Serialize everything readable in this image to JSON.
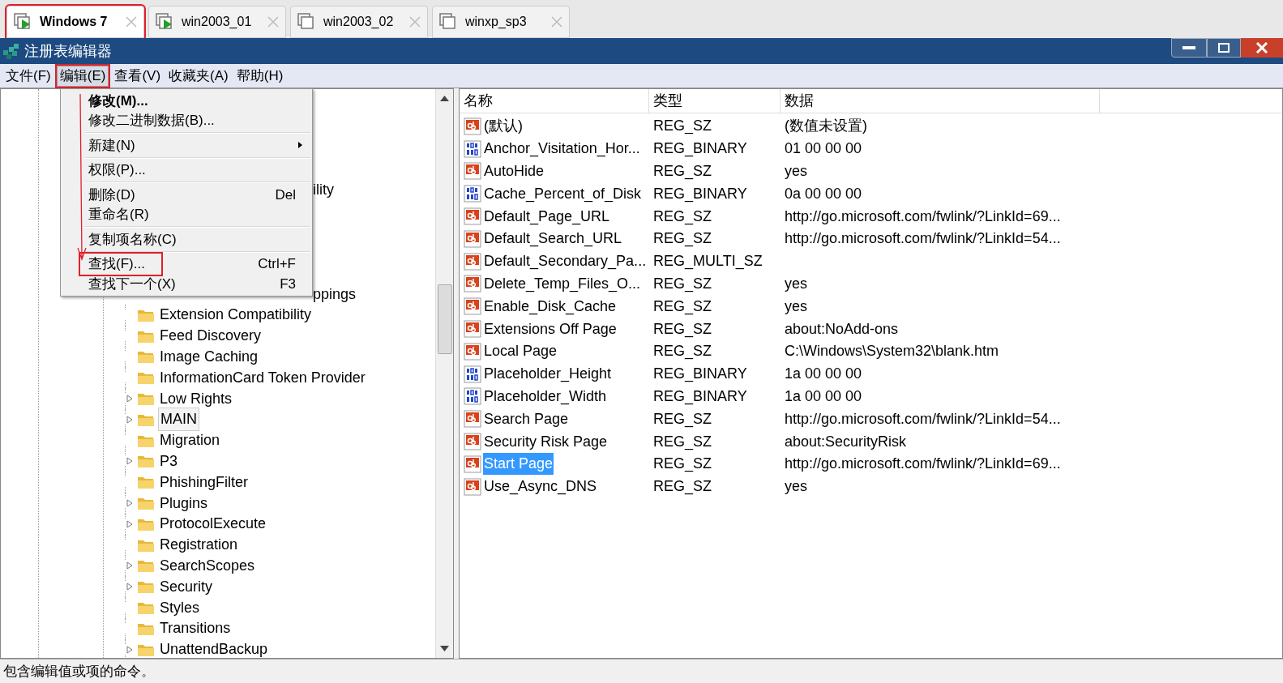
{
  "tabs": [
    {
      "label": "Windows 7",
      "selected": true,
      "running": true,
      "highlighted": true
    },
    {
      "label": "win2003_01",
      "selected": false,
      "running": true,
      "highlighted": false
    },
    {
      "label": "win2003_02",
      "selected": false,
      "running": false,
      "highlighted": false
    },
    {
      "label": "winxp_sp3",
      "selected": false,
      "running": false,
      "highlighted": false
    }
  ],
  "window": {
    "title": "注册表编辑器"
  },
  "menu_bar": [
    {
      "label": "文件(F)",
      "selected": false,
      "highlighted": false
    },
    {
      "label": "编辑(E)",
      "selected": true,
      "highlighted": true
    },
    {
      "label": "查看(V)",
      "selected": false,
      "highlighted": false
    },
    {
      "label": "收藏夹(A)",
      "selected": false,
      "highlighted": false
    },
    {
      "label": "帮助(H)",
      "selected": false,
      "highlighted": false
    }
  ],
  "edit_menu": [
    {
      "kind": "item",
      "label": "修改(M)...",
      "bold": true,
      "highlighted": false
    },
    {
      "kind": "item",
      "label": "修改二进制数据(B)...",
      "bold": false,
      "highlighted": false
    },
    {
      "kind": "separator"
    },
    {
      "kind": "submenu",
      "label": "新建(N)",
      "bold": false,
      "highlighted": false
    },
    {
      "kind": "separator"
    },
    {
      "kind": "item",
      "label": "权限(P)...",
      "bold": false,
      "highlighted": false
    },
    {
      "kind": "separator"
    },
    {
      "kind": "item",
      "label": "删除(D)",
      "shortcut": "Del",
      "bold": false,
      "highlighted": false
    },
    {
      "kind": "item",
      "label": "重命名(R)",
      "bold": false,
      "highlighted": false
    },
    {
      "kind": "separator"
    },
    {
      "kind": "item",
      "label": "复制项名称(C)",
      "bold": false,
      "highlighted": false
    },
    {
      "kind": "separator"
    },
    {
      "kind": "item",
      "label": "查找(F)...",
      "shortcut": "Ctrl+F",
      "bold": false,
      "highlighted": true
    },
    {
      "kind": "item",
      "label": "查找下一个(X)",
      "shortcut": "F3",
      "bold": false,
      "highlighted": false
    }
  ],
  "tree": [
    {
      "kind": "partial",
      "label": "ility"
    },
    {
      "kind": "partial",
      "label": "ppings"
    },
    {
      "kind": "key",
      "label": "Extension Compatibility",
      "expandable": false,
      "selected": false
    },
    {
      "kind": "key",
      "label": "Feed Discovery",
      "expandable": false,
      "selected": false
    },
    {
      "kind": "key",
      "label": "Image Caching",
      "expandable": false,
      "selected": false
    },
    {
      "kind": "key",
      "label": "InformationCard Token Provider",
      "expandable": false,
      "selected": false
    },
    {
      "kind": "key",
      "label": "Low Rights",
      "expandable": true,
      "selected": false
    },
    {
      "kind": "key",
      "label": "MAIN",
      "expandable": true,
      "selected": true
    },
    {
      "kind": "key",
      "label": "Migration",
      "expandable": false,
      "selected": false
    },
    {
      "kind": "key",
      "label": "P3",
      "expandable": true,
      "selected": false
    },
    {
      "kind": "key",
      "label": "PhishingFilter",
      "expandable": false,
      "selected": false
    },
    {
      "kind": "key",
      "label": "Plugins",
      "expandable": true,
      "selected": false
    },
    {
      "kind": "key",
      "label": "ProtocolExecute",
      "expandable": true,
      "selected": false
    },
    {
      "kind": "key",
      "label": "Registration",
      "expandable": false,
      "selected": false
    },
    {
      "kind": "key",
      "label": "SearchScopes",
      "expandable": true,
      "selected": false
    },
    {
      "kind": "key",
      "label": "Security",
      "expandable": true,
      "selected": false
    },
    {
      "kind": "key",
      "label": "Styles",
      "expandable": false,
      "selected": false
    },
    {
      "kind": "key",
      "label": "Transitions",
      "expandable": false,
      "selected": false
    },
    {
      "kind": "key",
      "label": "UnattendBackup",
      "expandable": true,
      "selected": false
    }
  ],
  "values_table": {
    "columns": [
      "名称",
      "类型",
      "数据"
    ],
    "rows": [
      {
        "kind": "string",
        "name": "(默认)",
        "type": "REG_SZ",
        "data": "(数值未设置)",
        "selected": false
      },
      {
        "kind": "binary",
        "name": "Anchor_Visitation_Hor...",
        "type": "REG_BINARY",
        "data": "01 00 00 00",
        "selected": false
      },
      {
        "kind": "string",
        "name": "AutoHide",
        "type": "REG_SZ",
        "data": "yes",
        "selected": false
      },
      {
        "kind": "binary",
        "name": "Cache_Percent_of_Disk",
        "type": "REG_BINARY",
        "data": "0a 00 00 00",
        "selected": false
      },
      {
        "kind": "string",
        "name": "Default_Page_URL",
        "type": "REG_SZ",
        "data": "http://go.microsoft.com/fwlink/?LinkId=69...",
        "selected": false
      },
      {
        "kind": "string",
        "name": "Default_Search_URL",
        "type": "REG_SZ",
        "data": "http://go.microsoft.com/fwlink/?LinkId=54...",
        "selected": false
      },
      {
        "kind": "string",
        "name": "Default_Secondary_Pa...",
        "type": "REG_MULTI_SZ",
        "selected": false
      },
      {
        "kind": "string",
        "name": "Delete_Temp_Files_O...",
        "type": "REG_SZ",
        "data": "yes",
        "selected": false
      },
      {
        "kind": "string",
        "name": "Enable_Disk_Cache",
        "type": "REG_SZ",
        "data": "yes",
        "selected": false
      },
      {
        "kind": "string",
        "name": "Extensions Off Page",
        "type": "REG_SZ",
        "data": "about:NoAdd-ons",
        "selected": false
      },
      {
        "kind": "string",
        "name": "Local Page",
        "type": "REG_SZ",
        "data": "C:\\Windows\\System32\\blank.htm",
        "selected": false
      },
      {
        "kind": "binary",
        "name": "Placeholder_Height",
        "type": "REG_BINARY",
        "data": "1a 00 00 00",
        "selected": false
      },
      {
        "kind": "binary",
        "name": "Placeholder_Width",
        "type": "REG_BINARY",
        "data": "1a 00 00 00",
        "selected": false
      },
      {
        "kind": "string",
        "name": "Search Page",
        "type": "REG_SZ",
        "data": "http://go.microsoft.com/fwlink/?LinkId=54...",
        "selected": false
      },
      {
        "kind": "string",
        "name": "Security Risk Page",
        "type": "REG_SZ",
        "data": "about:SecurityRisk",
        "selected": false
      },
      {
        "kind": "string",
        "name": "Start Page",
        "type": "REG_SZ",
        "data": "http://go.microsoft.com/fwlink/?LinkId=69...",
        "selected": true
      },
      {
        "kind": "string",
        "name": "Use_Async_DNS",
        "type": "REG_SZ",
        "data": "yes",
        "selected": false
      }
    ]
  },
  "status_bar": {
    "text": "包含编辑值或项的命令。"
  }
}
